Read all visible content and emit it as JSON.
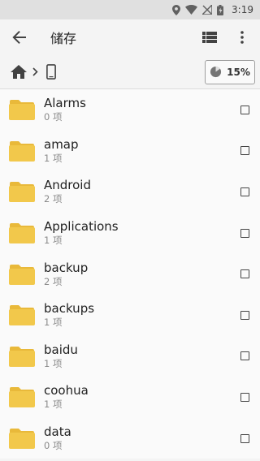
{
  "status_bar": {
    "time": "3:19"
  },
  "app_bar": {
    "title": "储存"
  },
  "path_bar": {
    "storage_percent": "15%"
  },
  "files": [
    {
      "name": "Alarms",
      "meta": "0 项"
    },
    {
      "name": "amap",
      "meta": "1 项"
    },
    {
      "name": "Android",
      "meta": "2 项"
    },
    {
      "name": "Applications",
      "meta": "1 项"
    },
    {
      "name": "backup",
      "meta": "2 项"
    },
    {
      "name": "backups",
      "meta": "1 项"
    },
    {
      "name": "baidu",
      "meta": "1 项"
    },
    {
      "name": "coohua",
      "meta": "1 项"
    },
    {
      "name": "data",
      "meta": "0 项"
    }
  ],
  "colors": {
    "folder": "#f2c84b",
    "folder_tab": "#e9b93a",
    "icon": "#424242",
    "status_icon": "#616161"
  },
  "storage_fraction": 0.15
}
